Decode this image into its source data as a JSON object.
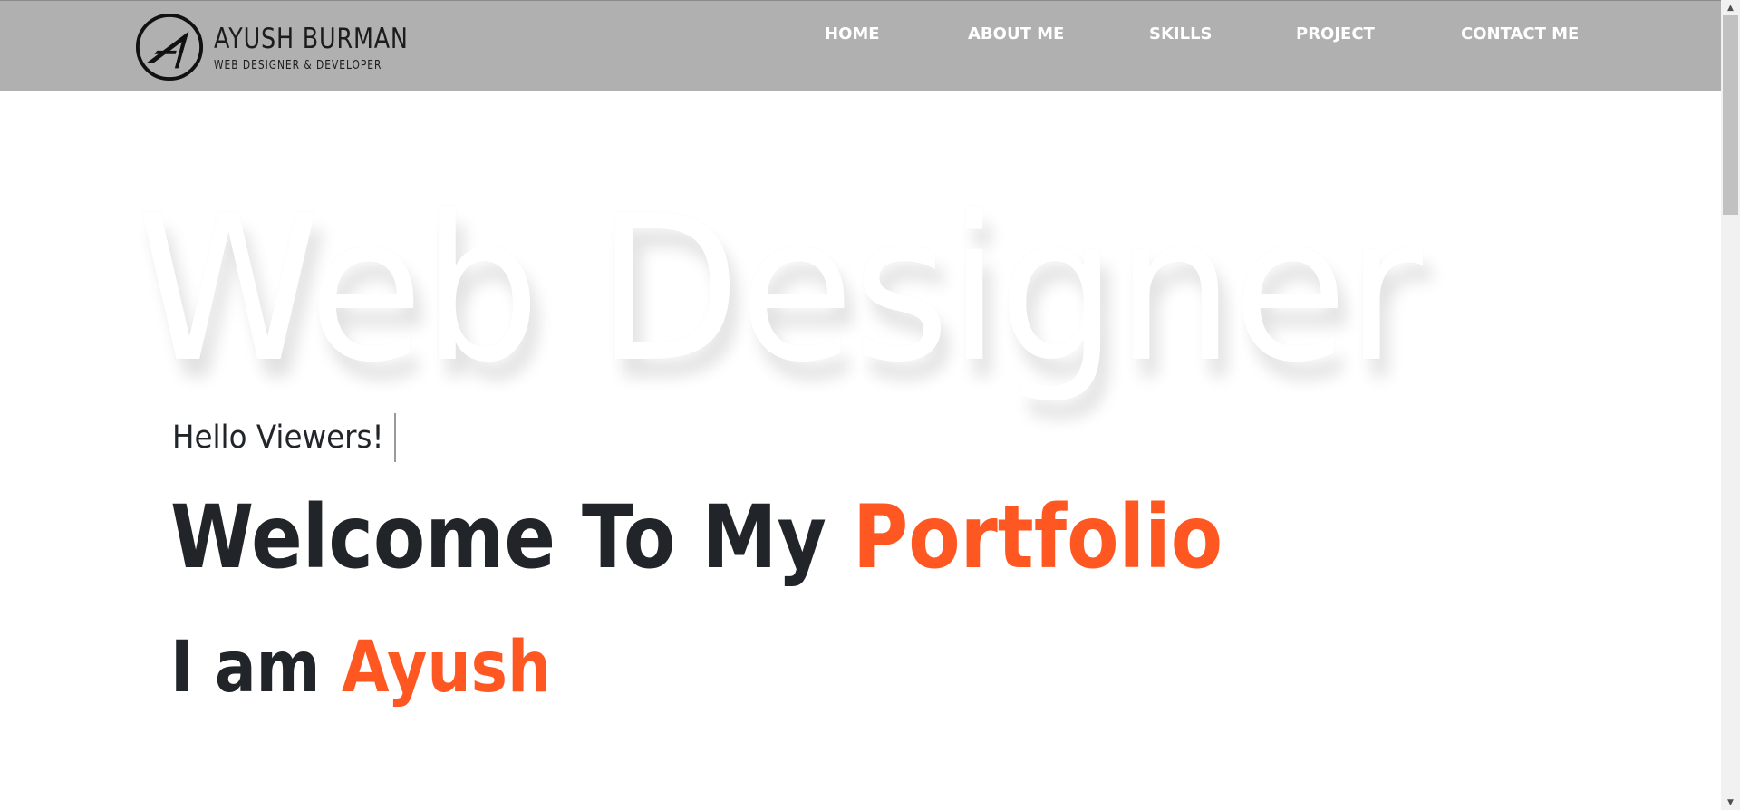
{
  "header": {
    "brand_name": "AYUSH BURMAN",
    "brand_tagline": "WEB DESIGNER & DEVELOPER",
    "background_color": "#b0b0b0",
    "nav": [
      {
        "label": "HOME"
      },
      {
        "label": "ABOUT ME"
      },
      {
        "label": "SKILLS"
      },
      {
        "label": "PROJECT"
      },
      {
        "label": "CONTACT ME"
      }
    ]
  },
  "hero": {
    "background_text": "Web Designer",
    "greeting": "Hello Viewers!",
    "welcome_prefix": "Welcome To My ",
    "welcome_highlight": "Portfolio",
    "intro_prefix": "I am ",
    "intro_highlight": "Ayush",
    "accent_color": "#ff5722",
    "text_color": "#212529"
  },
  "icons": {
    "logo": "brand-logo-icon",
    "scroll_up": "arrow-up-icon",
    "scroll_down": "arrow-down-icon"
  }
}
